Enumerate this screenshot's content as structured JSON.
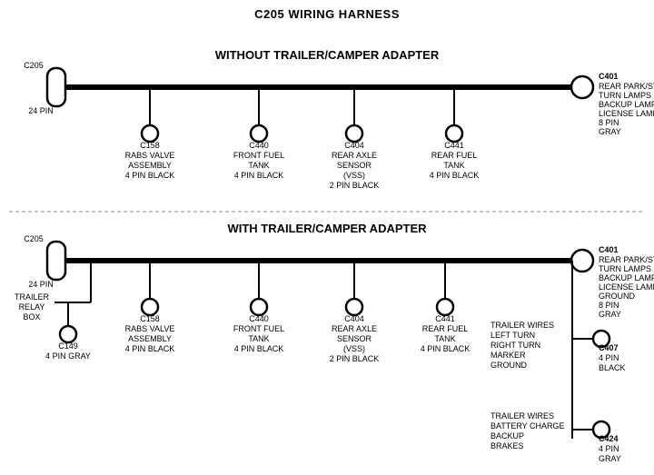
{
  "title": "C205 WIRING HARNESS",
  "section1": {
    "label": "WITHOUT TRAILER/CAMPER ADAPTER",
    "c205_label": "C205",
    "c205_pin": "24 PIN",
    "c401_label": "C401",
    "c401_pin": "8 PIN",
    "c401_color": "GRAY",
    "c401_desc": "REAR PARK/STOP\nTURN LAMPS\nBACKUP LAMPS\nLICENSE LAMPS",
    "connectors": [
      {
        "id": "C158",
        "label": "C158\nRABS VALVE\nASSEMBLY\n4 PIN BLACK"
      },
      {
        "id": "C440",
        "label": "C440\nFRONT FUEL\nTANK\n4 PIN BLACK"
      },
      {
        "id": "C404",
        "label": "C404\nREAR AXLE\nSENSOR\n(VSS)\n2 PIN BLACK"
      },
      {
        "id": "C441",
        "label": "C441\nREAR FUEL\nTANK\n4 PIN BLACK"
      }
    ]
  },
  "section2": {
    "label": "WITH TRAILER/CAMPER ADAPTER",
    "c205_label": "C205",
    "c205_pin": "24 PIN",
    "c401_label": "C401",
    "c401_pin": "8 PIN",
    "c401_color": "GRAY",
    "c401_desc": "REAR PARK/STOP\nTURN LAMPS\nBACKUP LAMPS\nLICENSE LAMPS\nGROUND",
    "trailer_relay": "TRAILER\nRELAY\nBOX",
    "c149_label": "C149\n4 PIN GRAY",
    "connectors": [
      {
        "id": "C158",
        "label": "C158\nRABS VALVE\nASSEMBLY\n4 PIN BLACK"
      },
      {
        "id": "C440",
        "label": "C440\nFRONT FUEL\nTANK\n4 PIN BLACK"
      },
      {
        "id": "C404",
        "label": "C404\nREAR AXLE\nSENSOR\n(VSS)\n2 PIN BLACK"
      },
      {
        "id": "C441",
        "label": "C441\nREAR FUEL\nTANK\n4 PIN BLACK"
      }
    ],
    "c407_label": "C407\n4 PIN\nBLACK",
    "c407_desc": "TRAILER WIRES\nLEFT TURN\nRIGHT TURN\nMARKER\nGROUND",
    "c424_label": "C424\n4 PIN\nGRAY",
    "c424_desc": "TRAILER WIRES\nBATTERY CHARGE\nBACKUP\nBRAKES"
  }
}
